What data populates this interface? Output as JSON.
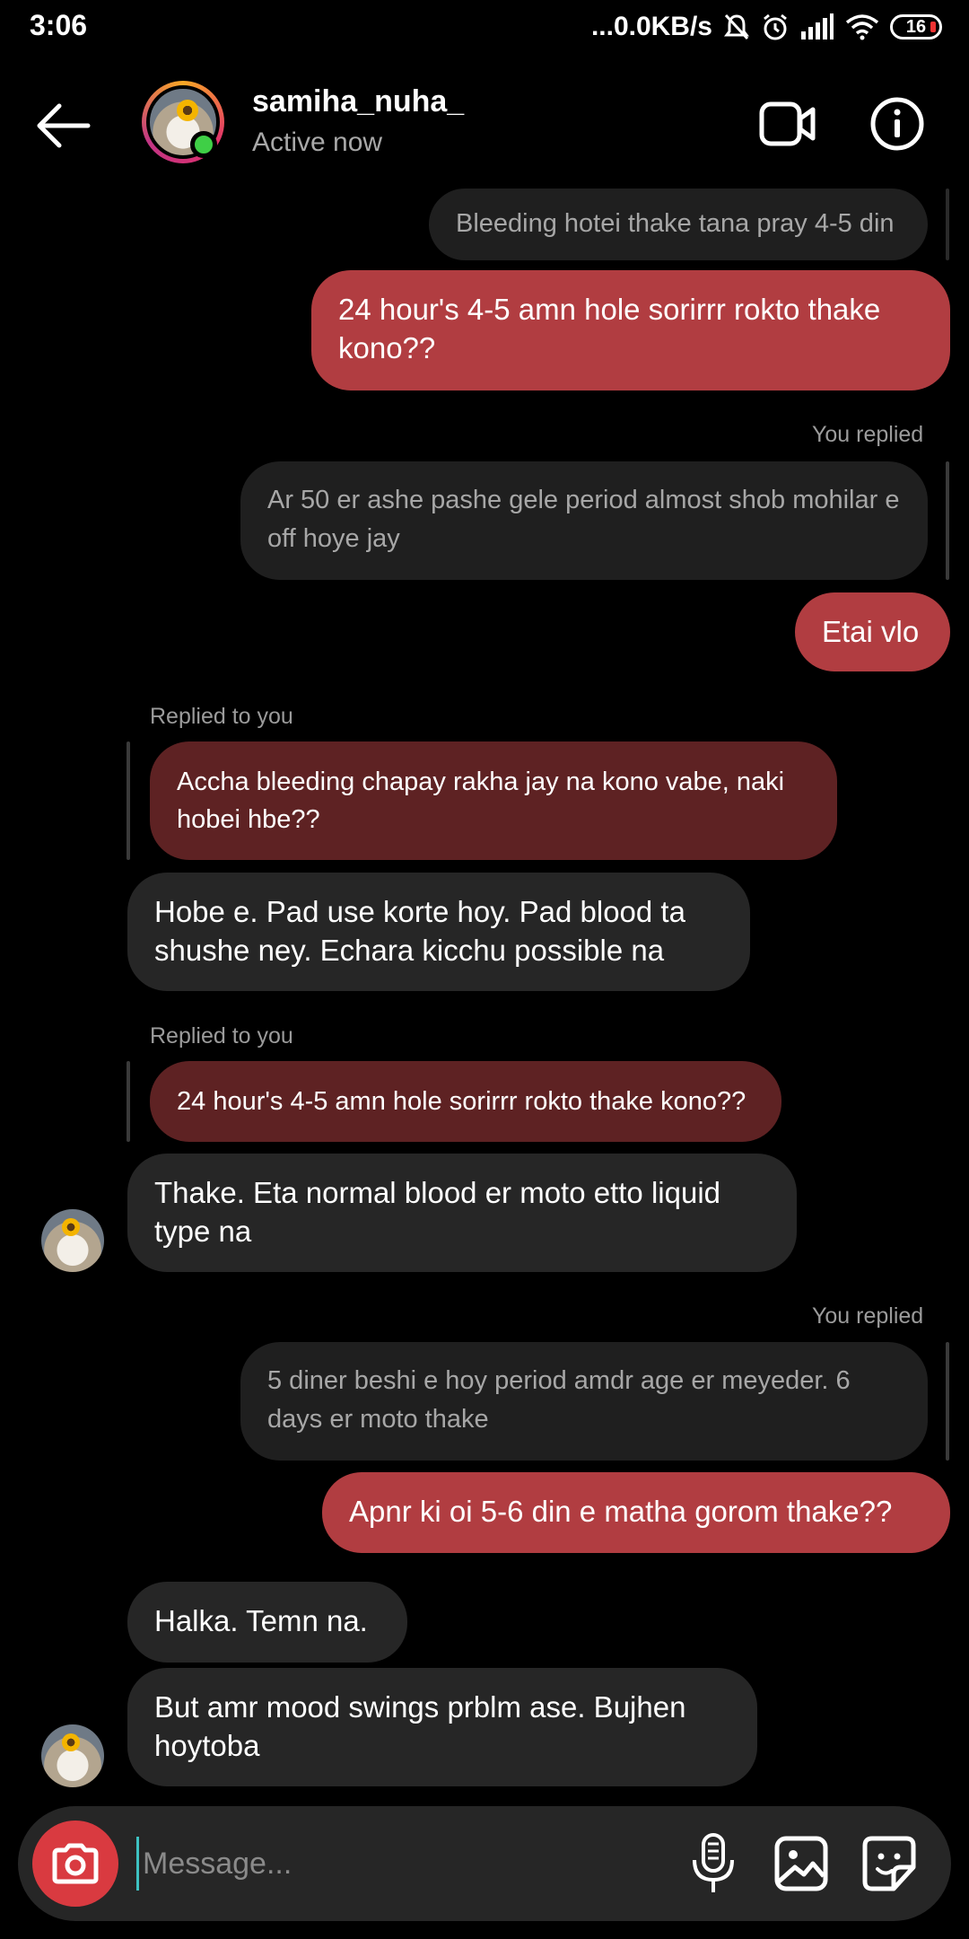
{
  "status_bar": {
    "time": "3:06",
    "network_speed": "...0.0KB/s",
    "battery": "16"
  },
  "header": {
    "username": "samiha_nuha_",
    "status": "Active now"
  },
  "messages": [
    {
      "type": "quote",
      "text": "Bleeding hotei thake tana pray 4-5 din"
    },
    {
      "type": "sent",
      "text": "24 hour's 4-5 amn hole sorirrr rokto thake kono??"
    },
    {
      "type": "reply_label",
      "text": "You replied"
    },
    {
      "type": "quote",
      "text": "Ar 50 er ashe pashe gele period almost shob mohilar e off hoye jay"
    },
    {
      "type": "sent",
      "text": "Etai vlo"
    },
    {
      "type": "reply_label",
      "text": "Replied to you"
    },
    {
      "type": "quote_red",
      "text": "Accha bleeding chapay rakha jay na kono vabe, naki hobei hbe??"
    },
    {
      "type": "received",
      "text": "Hobe e. Pad use korte hoy. Pad blood ta shushe ney. Echara  kicchu possible na"
    },
    {
      "type": "reply_label",
      "text": "Replied to you"
    },
    {
      "type": "quote_red",
      "text": "24 hour's 4-5 amn hole sorirrr rokto thake kono??"
    },
    {
      "type": "received",
      "text": "Thake. Eta normal blood er moto etto liquid type na"
    },
    {
      "type": "reply_label",
      "text": "You replied"
    },
    {
      "type": "quote",
      "text": "5 diner beshi e hoy period amdr age er meyeder. 6 days er moto thake"
    },
    {
      "type": "sent",
      "text": "Apnr ki oi 5-6 din e matha gorom thake??"
    },
    {
      "type": "received",
      "text": "Halka. Temn na."
    },
    {
      "type": "received",
      "text": "But amr mood swings prblm ase. Bujhen hoytoba"
    }
  ],
  "composer": {
    "placeholder": "Message..."
  },
  "colors": {
    "sent_bubble": "#b13d41",
    "received_bubble": "#262626",
    "quoted_reply_red": "#5e2223",
    "camera_button": "#d93a40",
    "online": "#3fcf46"
  },
  "icons": [
    "back-arrow-icon",
    "video-call-icon",
    "info-icon",
    "camera-icon",
    "microphone-icon",
    "gallery-icon",
    "sticker-icon"
  ]
}
